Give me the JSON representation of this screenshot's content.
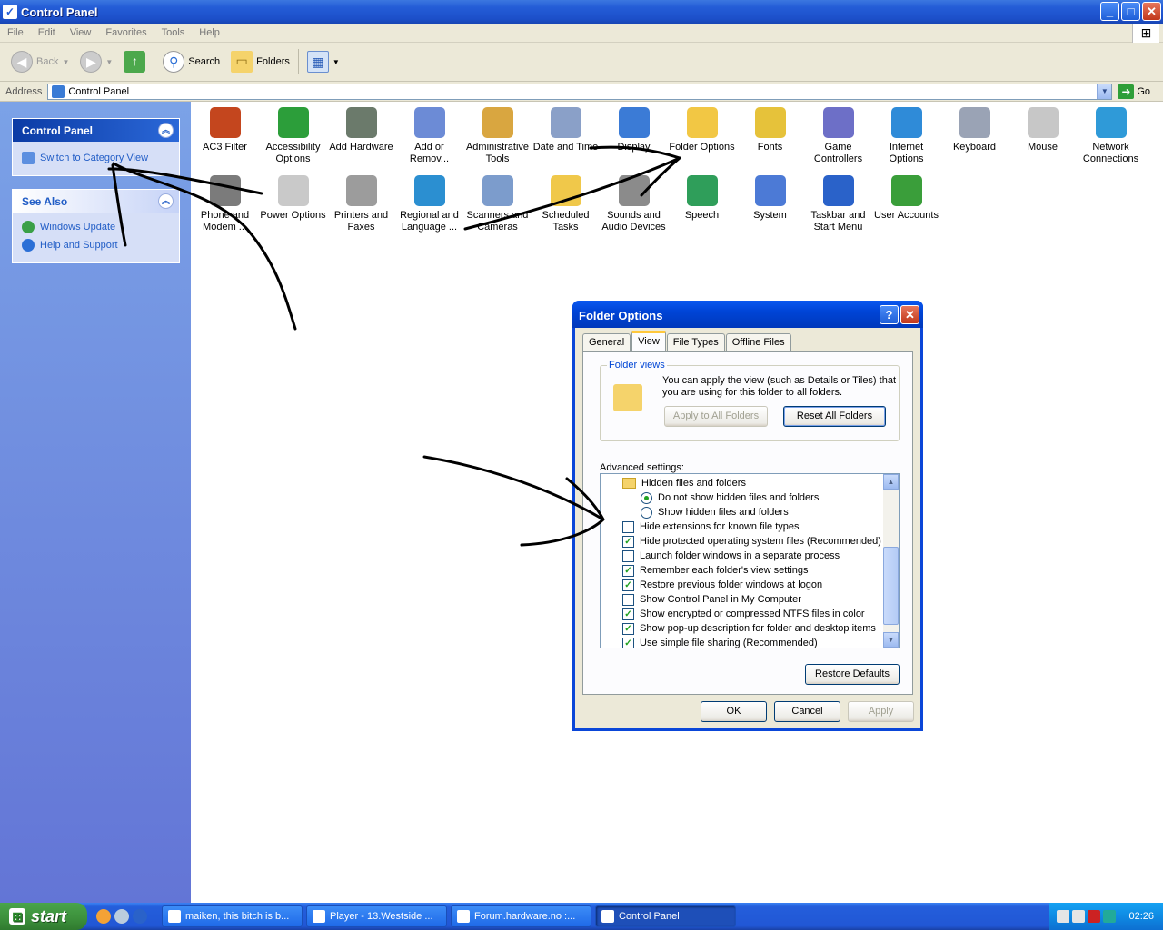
{
  "window": {
    "title": "Control Panel",
    "min": "_",
    "max": "□",
    "close": "✕"
  },
  "menu": [
    "File",
    "Edit",
    "View",
    "Favorites",
    "Tools",
    "Help"
  ],
  "toolbar": {
    "back": "Back",
    "search": "Search",
    "folders": "Folders"
  },
  "address": {
    "label": "Address",
    "value": "Control Panel",
    "go": "Go"
  },
  "sidebar": {
    "control_panel": {
      "title": "Control Panel",
      "link": "Switch to Category View"
    },
    "see_also": {
      "title": "See Also",
      "links": [
        "Windows Update",
        "Help and Support"
      ]
    }
  },
  "icons": [
    {
      "label": "AC3 Filter",
      "color": "#c4461e"
    },
    {
      "label": "Accessibility Options",
      "color": "#2c9e3a"
    },
    {
      "label": "Add Hardware",
      "color": "#6b7a6b"
    },
    {
      "label": "Add or Remov...",
      "color": "#6c8bd6"
    },
    {
      "label": "Administrative Tools",
      "color": "#d9a640"
    },
    {
      "label": "Date and Time",
      "color": "#8aa0c8"
    },
    {
      "label": "Display",
      "color": "#3b7bd6"
    },
    {
      "label": "Folder Options",
      "color": "#f2c744"
    },
    {
      "label": "Fonts",
      "color": "#e6c23a"
    },
    {
      "label": "Game Controllers",
      "color": "#6d6fc7"
    },
    {
      "label": "Internet Options",
      "color": "#2f8bd8"
    },
    {
      "label": "Keyboard",
      "color": "#9aa3b5"
    },
    {
      "label": "Mouse",
      "color": "#c7c7c7"
    },
    {
      "label": "Network Connections",
      "color": "#2f9ad8"
    },
    {
      "label": "Phone and Modem ...",
      "color": "#7b7b7b"
    },
    {
      "label": "Power Options",
      "color": "#c9c9c9"
    },
    {
      "label": "Printers and Faxes",
      "color": "#9c9c9c"
    },
    {
      "label": "Regional and Language ...",
      "color": "#2b8fd1"
    },
    {
      "label": "Scanners and Cameras",
      "color": "#7c9ccc"
    },
    {
      "label": "Scheduled Tasks",
      "color": "#f0c84a"
    },
    {
      "label": "Sounds and Audio Devices",
      "color": "#8b8b8b"
    },
    {
      "label": "Speech",
      "color": "#2f9e5a"
    },
    {
      "label": "System",
      "color": "#4c7ad6"
    },
    {
      "label": "Taskbar and Start Menu",
      "color": "#2a62c9"
    },
    {
      "label": "User Accounts",
      "color": "#3a9e3a"
    }
  ],
  "dialog": {
    "title": "Folder Options",
    "help": "?",
    "close": "✕",
    "tabs": [
      "General",
      "View",
      "File Types",
      "Offline Files"
    ],
    "folder_views": {
      "legend": "Folder views",
      "text": "You can apply the view (such as Details or Tiles) that you are using for this folder to all folders.",
      "apply_all": "Apply to All Folders",
      "reset_all": "Reset All Folders"
    },
    "advanced_label": "Advanced settings:",
    "settings": [
      {
        "kind": "folder",
        "label": "Hidden files and folders"
      },
      {
        "kind": "radio",
        "checked": true,
        "label": "Do not show hidden files and folders"
      },
      {
        "kind": "radio",
        "checked": false,
        "label": "Show hidden files and folders"
      },
      {
        "kind": "check",
        "checked": false,
        "label": "Hide extensions for known file types"
      },
      {
        "kind": "check",
        "checked": true,
        "label": "Hide protected operating system files (Recommended)"
      },
      {
        "kind": "check",
        "checked": false,
        "label": "Launch folder windows in a separate process"
      },
      {
        "kind": "check",
        "checked": true,
        "label": "Remember each folder's view settings"
      },
      {
        "kind": "check",
        "checked": true,
        "label": "Restore previous folder windows at logon"
      },
      {
        "kind": "check",
        "checked": false,
        "label": "Show Control Panel in My Computer"
      },
      {
        "kind": "check",
        "checked": true,
        "label": "Show encrypted or compressed NTFS files in color"
      },
      {
        "kind": "check",
        "checked": true,
        "label": "Show pop-up description for folder and desktop items"
      },
      {
        "kind": "check",
        "checked": true,
        "label": "Use simple file sharing (Recommended)"
      }
    ],
    "restore_defaults": "Restore Defaults",
    "ok": "OK",
    "cancel": "Cancel",
    "apply": "Apply"
  },
  "taskbar": {
    "start": "start",
    "tasks": [
      {
        "label": "maiken, this bitch is b...",
        "active": false
      },
      {
        "label": "Player - 13.Westside ...",
        "active": false
      },
      {
        "label": "Forum.hardware.no :...",
        "active": false
      },
      {
        "label": "Control Panel",
        "active": true
      }
    ],
    "clock": "02:26"
  }
}
